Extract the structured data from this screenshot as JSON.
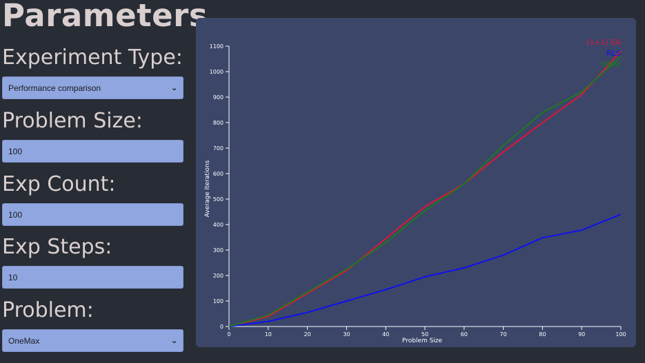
{
  "sidebar": {
    "title": "Parameters",
    "fields": {
      "experiment_type": {
        "label": "Experiment Type:",
        "value": "Performance comparison"
      },
      "problem_size": {
        "label": "Problem Size:",
        "value": "100"
      },
      "exp_count": {
        "label": "Exp Count:",
        "value": "100"
      },
      "exp_steps": {
        "label": "Exp Steps:",
        "value": "10"
      },
      "problem": {
        "label": "Problem:",
        "value": "OneMax"
      }
    }
  },
  "colors": {
    "page_bg": "#282c34",
    "chart_bg": "#3b4669",
    "field_bg": "#8fa6e0"
  },
  "chart_data": {
    "type": "line",
    "xlabel": "Problem Size",
    "ylabel": "Average Iterations",
    "x": [
      0,
      10,
      20,
      30,
      40,
      50,
      60,
      70,
      80,
      90,
      100
    ],
    "xlim": [
      0,
      100
    ],
    "ylim": [
      0,
      1100
    ],
    "xticks": [
      0,
      10,
      20,
      30,
      40,
      50,
      60,
      70,
      80,
      90,
      100
    ],
    "yticks": [
      0,
      100,
      200,
      300,
      400,
      500,
      600,
      700,
      800,
      900,
      1000,
      1100
    ],
    "legend_position": "top-right",
    "series": [
      {
        "name": "(1+1) EA",
        "color": "#e0153a",
        "values": [
          0,
          40,
          130,
          220,
          345,
          470,
          560,
          685,
          800,
          910,
          1080
        ]
      },
      {
        "name": "RLS",
        "color": "#1010ee",
        "values": [
          0,
          20,
          55,
          100,
          145,
          195,
          230,
          280,
          348,
          378,
          440
        ]
      },
      {
        "name": "MBNI",
        "color": "#1e7a1e",
        "values": [
          0,
          45,
          135,
          225,
          330,
          455,
          560,
          710,
          840,
          920,
          1060
        ]
      }
    ]
  }
}
